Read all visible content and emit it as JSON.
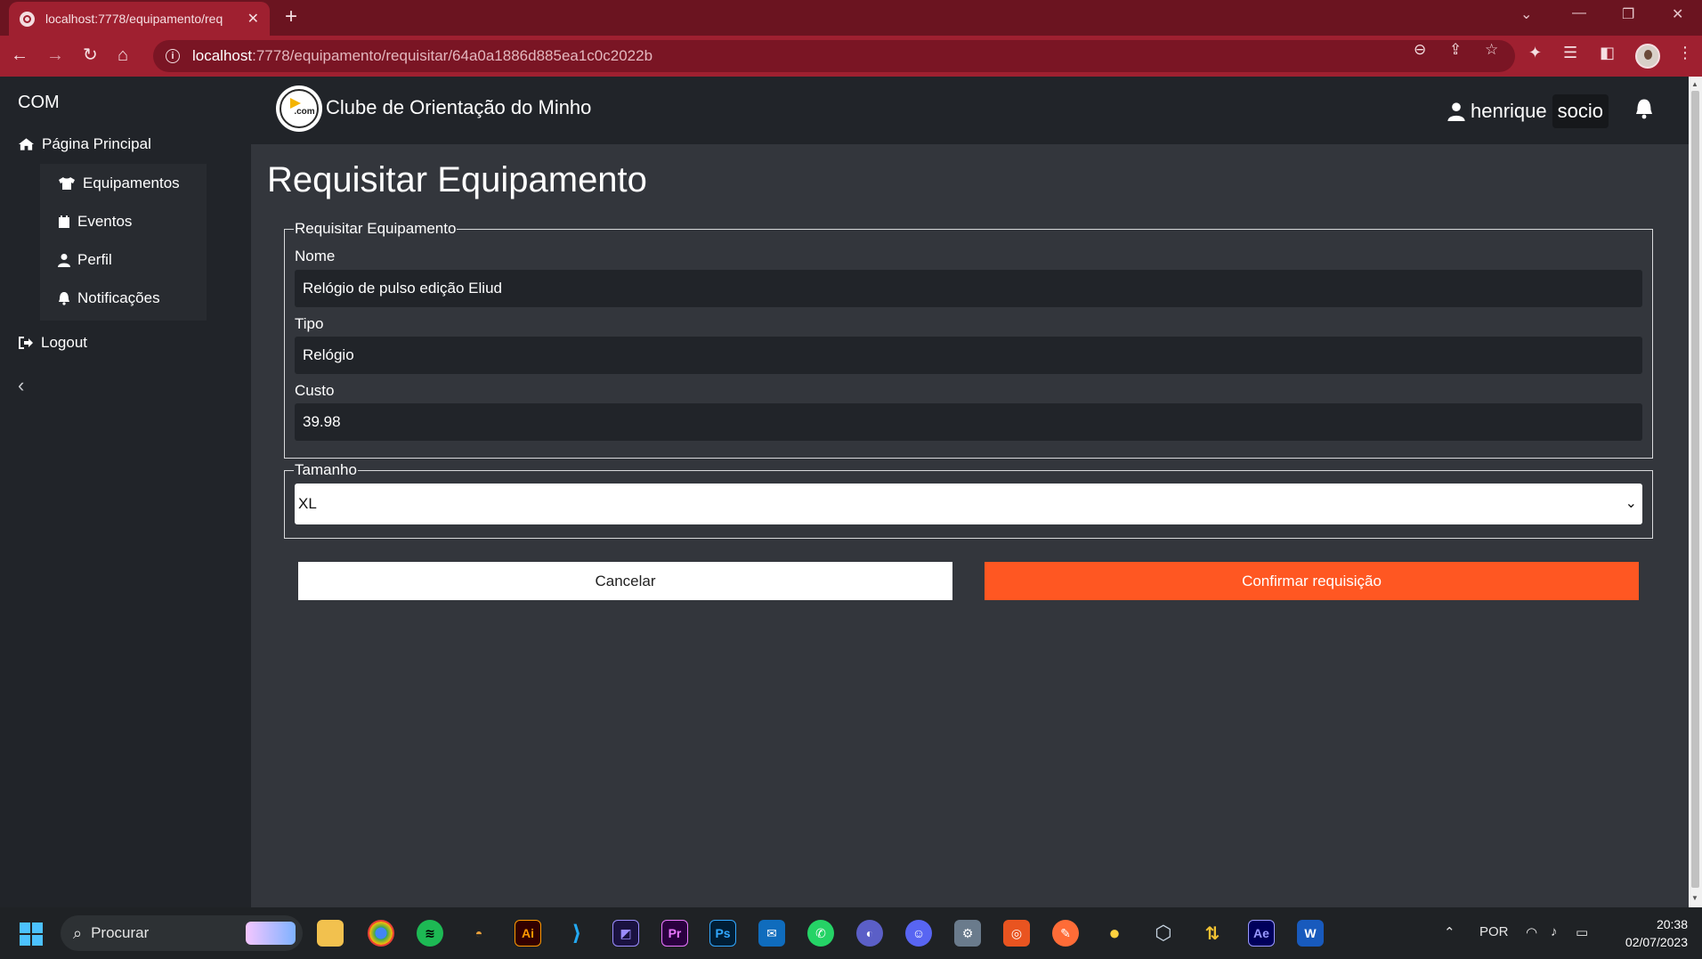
{
  "browser": {
    "tab_title": "localhost:7778/equipamento/req",
    "url_host": "localhost",
    "url_path": ":7778/equipamento/requisitar/64a0a1886d885ea1c0c2022b"
  },
  "sidebar": {
    "brand": "COM",
    "main_link": "Página Principal",
    "items": [
      {
        "label": "Equipamentos",
        "icon": "shirt-icon"
      },
      {
        "label": "Eventos",
        "icon": "calendar-icon"
      },
      {
        "label": "Perfil",
        "icon": "user-icon"
      },
      {
        "label": "Notificações",
        "icon": "bell-icon"
      }
    ],
    "logout": "Logout"
  },
  "header": {
    "logo_text": ".com",
    "site_title": "Clube de Orientação do Minho",
    "user_name": "henrique",
    "user_role": "socio"
  },
  "page": {
    "title": "Requisitar Equipamento",
    "details_legend": "Requisitar Equipamento",
    "fields": [
      {
        "label": "Nome",
        "value": "Relógio de pulso edição Eliud"
      },
      {
        "label": "Tipo",
        "value": "Relógio"
      },
      {
        "label": "Custo",
        "value": "39.98"
      }
    ],
    "size_legend": "Tamanho",
    "size_selected": "XL",
    "cancel_label": "Cancelar",
    "confirm_label": "Confirmar requisição"
  },
  "taskbar": {
    "search_label": "Procurar",
    "language": "POR",
    "time": "20:38",
    "date": "02/07/2023"
  },
  "colors": {
    "accent": "#ff5722",
    "sidebar_bg": "#212429",
    "page_bg": "#33363c",
    "browser_frame": "#9f2030"
  }
}
